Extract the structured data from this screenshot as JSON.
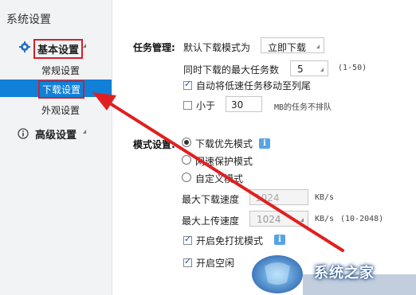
{
  "sidebar": {
    "title": "系统设置",
    "groups": [
      {
        "label": "基本设置",
        "icon": "gear-icon"
      },
      {
        "label": "高级设置",
        "icon": "info-icon"
      }
    ],
    "items": [
      {
        "label": "常规设置"
      },
      {
        "label": "下载设置"
      },
      {
        "label": "外观设置"
      }
    ]
  },
  "task": {
    "section_label": "任务管理:",
    "default_mode_label": "默认下载模式为",
    "default_mode_value": "立即下载",
    "max_tasks_label": "同时下载的最大任务数",
    "max_tasks_value": "5",
    "max_tasks_hint": "(1-50)",
    "auto_move_label": "自动将低速任务移动至列尾",
    "auto_move_checked": true,
    "less_than_label": "小于",
    "less_than_checked": false,
    "less_than_value": "30",
    "less_than_suffix": "MB的任务不排队"
  },
  "mode": {
    "section_label": "模式设置:",
    "options": [
      {
        "label": "下载优先模式",
        "selected": true
      },
      {
        "label": "网速保护模式",
        "selected": false
      },
      {
        "label": "自定义模式",
        "selected": false
      }
    ],
    "max_download_label": "最大下载速度",
    "max_download_value": "1024",
    "max_download_unit": "KB/s",
    "max_upload_label": "最大上传速度",
    "max_upload_value": "1024",
    "max_upload_unit": "KB/s",
    "max_upload_hint": "(10-2048)",
    "free_disturb_label": "开启免打扰模式",
    "free_disturb_checked": true,
    "idle_label": "开启空闲",
    "idle_checked": true
  },
  "watermark": {
    "text": "系统之家"
  },
  "colors": {
    "selected": "#1080d8",
    "highlight_box": "#d4202a",
    "arrow": "#e02020",
    "info_badge": "#5aa3e2"
  }
}
